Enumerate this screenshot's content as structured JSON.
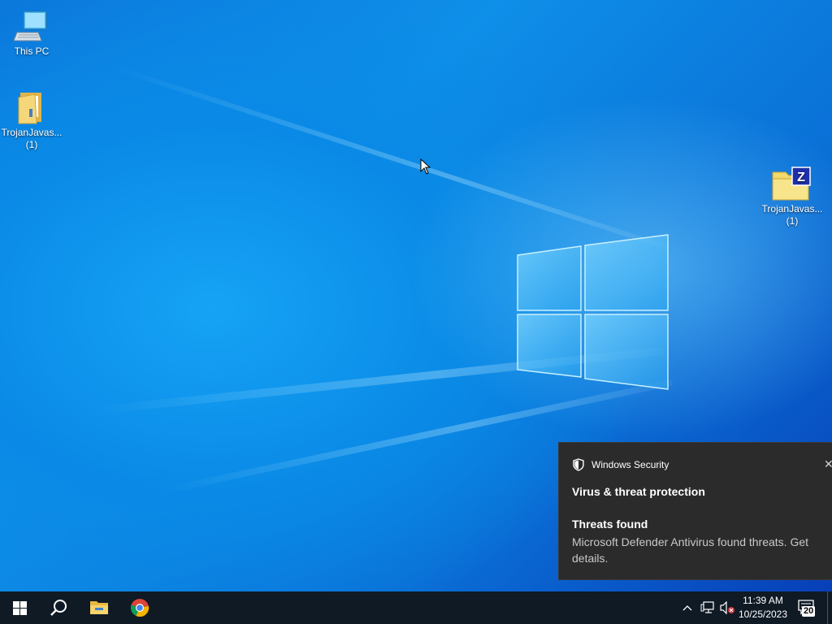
{
  "desktop": {
    "icons": [
      {
        "label": "This PC"
      },
      {
        "label": "TrojanJavas...",
        "sublabel": "(1)"
      },
      {
        "label": "TrojanJavas...",
        "sublabel": "(1)"
      }
    ]
  },
  "toast": {
    "app_name": "Windows Security",
    "title": "Virus & threat protection",
    "subtitle": "Threats found",
    "body": "Microsoft Defender Antivirus found threats. Get details.",
    "close_glyph": "✕"
  },
  "taskbar": {
    "clock_time": "11:39 AM",
    "clock_date": "10/25/2023",
    "notification_count": "20",
    "pinned": [
      "windows-start-icon",
      "search-icon",
      "file-explorer-icon",
      "chrome-icon"
    ]
  },
  "colors": {
    "taskbar_bg": "#0f1a25",
    "toast_bg": "#2b2b2b",
    "accent": "#0078d7"
  }
}
